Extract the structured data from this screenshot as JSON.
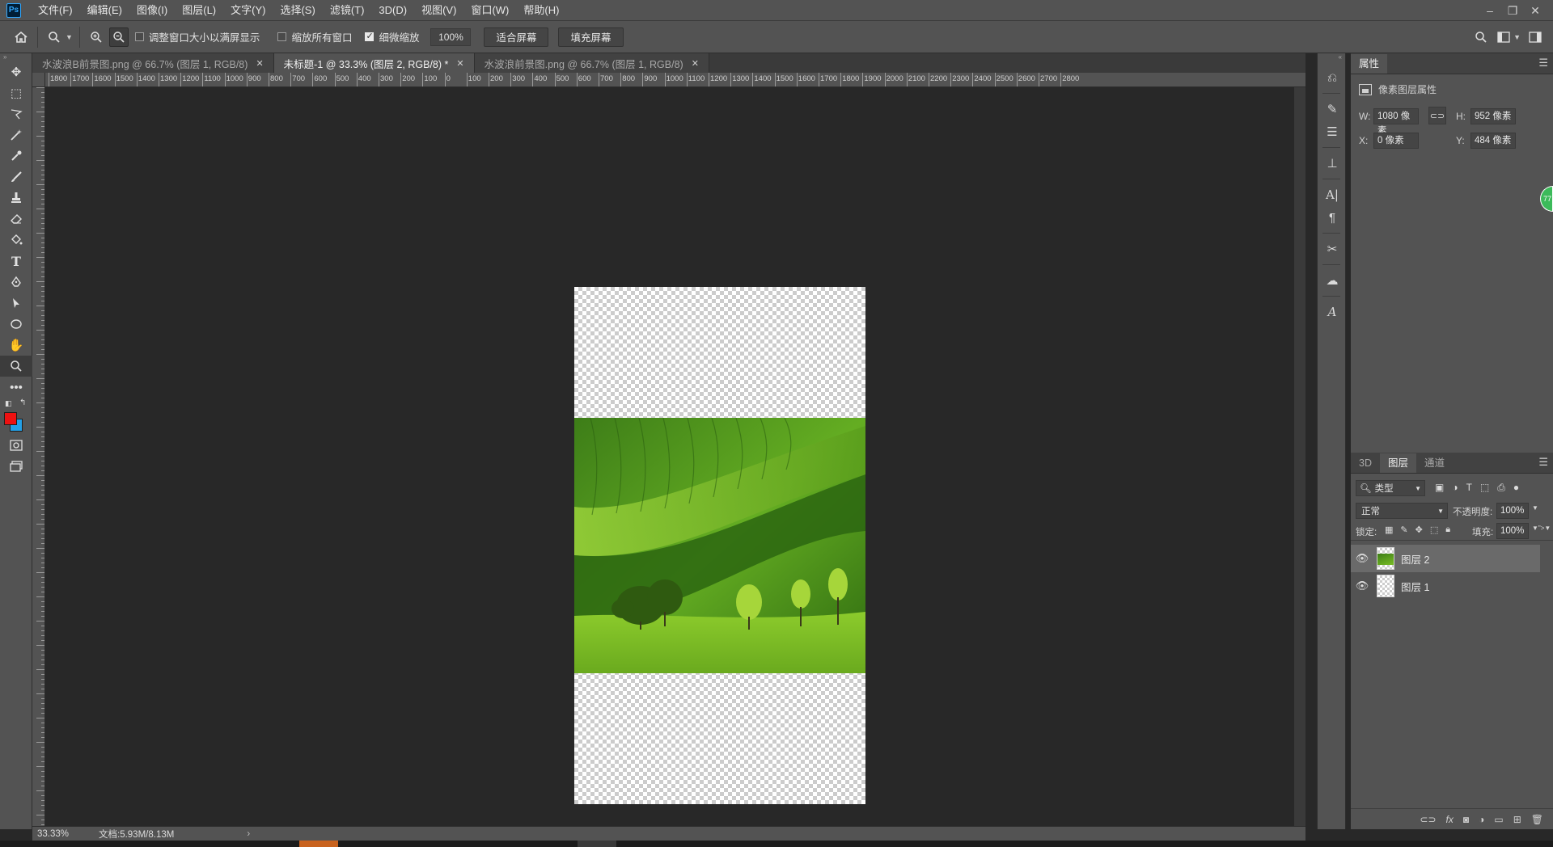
{
  "app": {
    "logo": "Ps",
    "menu": [
      "文件(F)",
      "编辑(E)",
      "图像(I)",
      "图层(L)",
      "文字(Y)",
      "选择(S)",
      "滤镜(T)",
      "3D(D)",
      "视图(V)",
      "窗口(W)",
      "帮助(H)"
    ]
  },
  "options": {
    "resize_windows_label": "调整窗口大小以满屏显示",
    "zoom_all_label": "缩放所有窗口",
    "scrubby_zoom_label": "细微缩放",
    "zoom_value": "100%",
    "fit_screen_label": "适合屏幕",
    "fill_screen_label": "填充屏幕"
  },
  "tabs": [
    {
      "label": "水波浪B前景图.png @ 66.7% (图层 1, RGB/8)",
      "active": false
    },
    {
      "label": "未标题-1 @ 33.3% (图层 2, RGB/8) *",
      "active": true
    },
    {
      "label": "水波浪前景图.png @ 66.7% (图层 1, RGB/8)",
      "active": false
    }
  ],
  "ruler_h": [
    "1800",
    "1700",
    "1600",
    "1500",
    "1400",
    "1300",
    "1200",
    "1100",
    "1000",
    "900",
    "800",
    "700",
    "600",
    "500",
    "400",
    "300",
    "200",
    "100",
    "0",
    "100",
    "200",
    "300",
    "400",
    "500",
    "600",
    "700",
    "800",
    "900",
    "1000",
    "1100",
    "1200",
    "1300",
    "1400",
    "1500",
    "1600",
    "1700",
    "1800",
    "1900",
    "2000",
    "2100",
    "2200",
    "2300",
    "2400",
    "2500",
    "2600",
    "2700",
    "2800"
  ],
  "properties": {
    "tab": "属性",
    "header": "像素图层属性",
    "w_label": "W:",
    "w_value": "1080 像素",
    "h_label": "H:",
    "h_value": "952 像素",
    "x_label": "X:",
    "x_value": "0 像素",
    "y_label": "Y:",
    "y_value": "484 像素",
    "badge": "77"
  },
  "layers_panel": {
    "tabs": [
      "3D",
      "图层",
      "通道"
    ],
    "active_tab": "图层",
    "filter_label": "类型",
    "blend_mode": "正常",
    "opacity_label": "不透明度:",
    "opacity_value": "100%",
    "lock_label": "锁定:",
    "fill_label": "填充:",
    "fill_value": "100%",
    "layers": [
      {
        "name": "图层 2",
        "selected": true
      },
      {
        "name": "图层 1",
        "selected": false
      }
    ]
  },
  "status": {
    "zoom": "33.33%",
    "doc": "文档:5.93M/8.13M"
  }
}
